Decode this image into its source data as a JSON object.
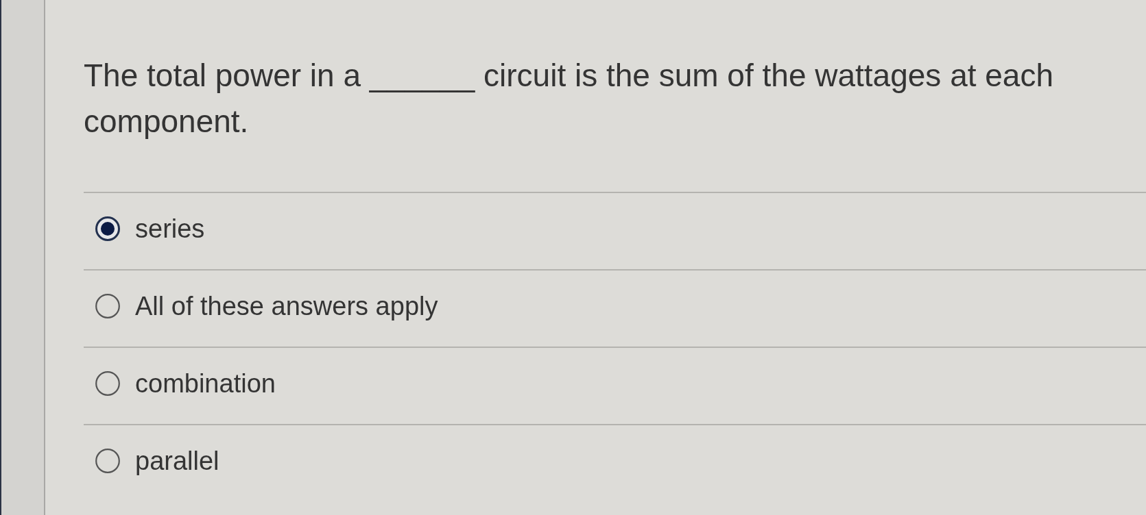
{
  "question": {
    "text": "The total power in a ______ circuit is the sum of the wattages at each component."
  },
  "options": [
    {
      "label": "series",
      "selected": true
    },
    {
      "label": "All of these answers apply",
      "selected": false
    },
    {
      "label": "combination",
      "selected": false
    },
    {
      "label": "parallel",
      "selected": false
    }
  ]
}
